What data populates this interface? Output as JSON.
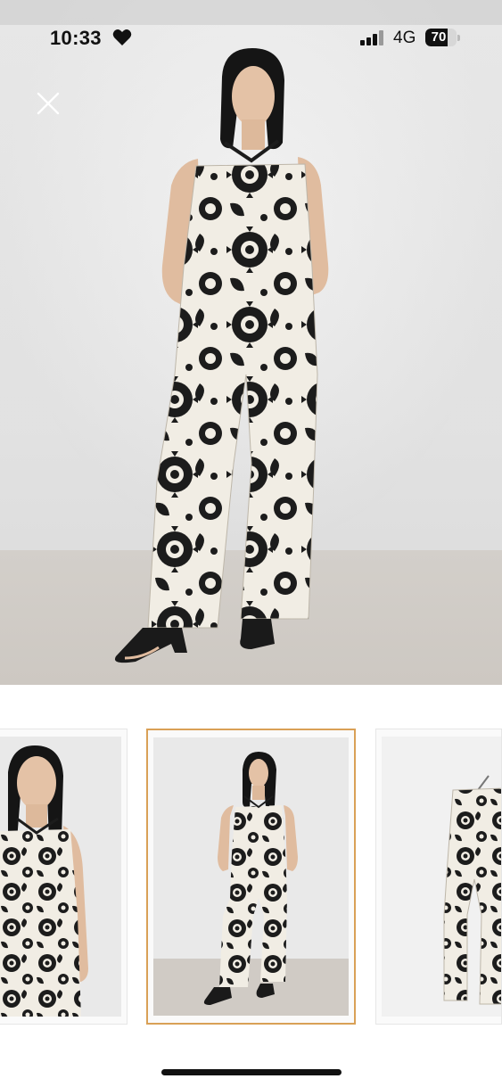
{
  "status_bar": {
    "time": "10:33",
    "network": "4G",
    "battery_percent": "70",
    "battery_level": 0.7
  },
  "icons": {
    "close": "close-icon",
    "heart": "heart-icon",
    "signal": "signal-icon",
    "battery": "battery-icon"
  },
  "gallery": {
    "selected_index": 1,
    "thumbnails": [
      {
        "view": "close-up"
      },
      {
        "view": "full-length"
      },
      {
        "view": "product-flat"
      }
    ]
  },
  "colors": {
    "selected_border": "#d9a056",
    "print_dark": "#1c1c1c",
    "fabric": "#f1ede4"
  }
}
